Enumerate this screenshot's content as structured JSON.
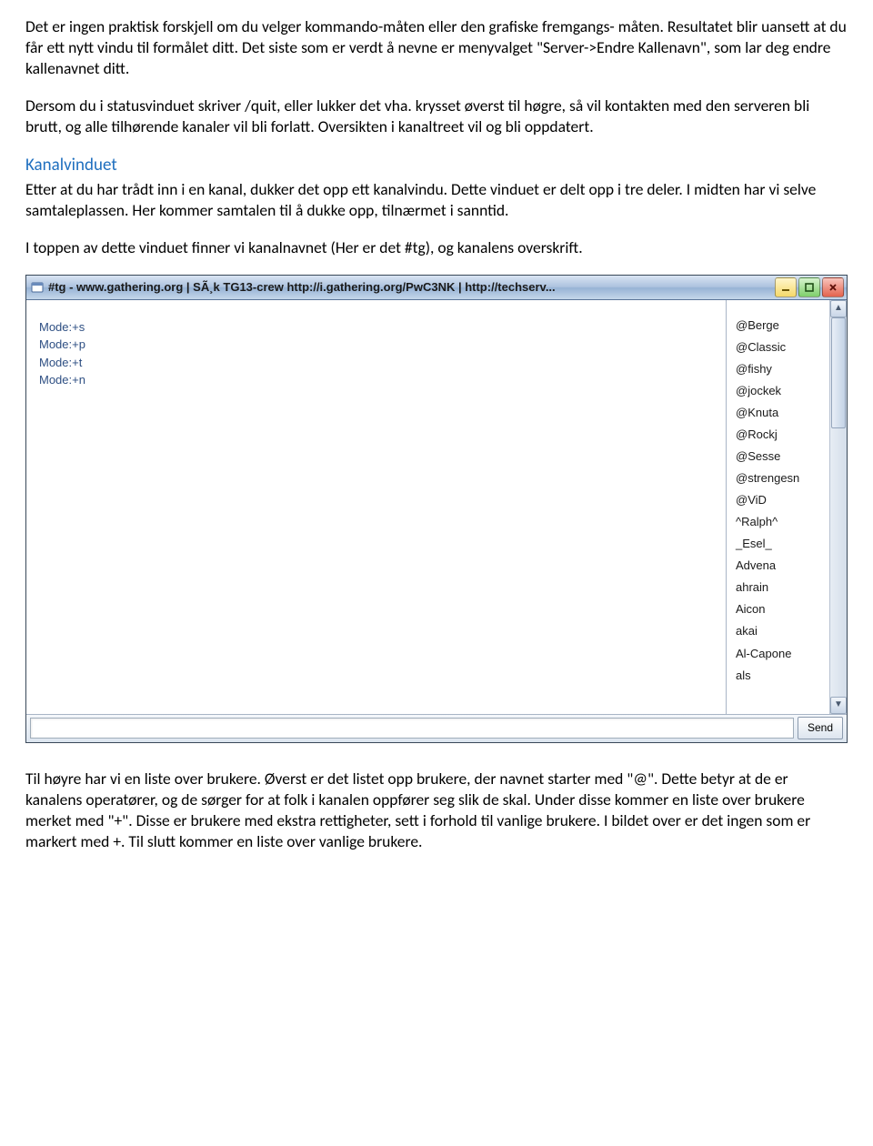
{
  "doc": {
    "p1": "Det er ingen praktisk forskjell om du velger kommando-måten eller den grafiske fremgangs- måten. Resultatet blir uansett at du får ett nytt vindu til formålet ditt. Det siste som er verdt å nevne er menyvalget \"Server->Endre Kallenavn\", som lar deg endre kallenavnet ditt.",
    "p2": "Dersom du i statusvinduet skriver /quit, eller lukker det vha. krysset øverst til høgre, så vil kontakten med den serveren bli brutt, og alle tilhørende kanaler vil bli forlatt. Oversikten i kanaltreet vil og bli oppdatert.",
    "heading": "Kanalvinduet",
    "p3": "Etter at du har trådt inn i en kanal, dukker det opp ett kanalvindu. Dette vinduet er delt opp i tre deler. I midten har vi selve samtaleplassen. Her kommer samtalen til å dukke opp, tilnærmet i sanntid.",
    "p4": "I toppen av dette vinduet finner vi kanalnavnet (Her er det #tg), og kanalens overskrift.",
    "p5": "Til høyre har vi en liste over brukere. Øverst er det listet opp brukere, der navnet starter med \"@\". Dette betyr at de er kanalens operatører, og de sørger for at folk i kanalen oppfører seg slik de skal. Under disse kommer en liste over brukere merket med \"+\". Disse er brukere med ekstra rettigheter, sett i forhold til vanlige brukere. I bildet over er det ingen som er markert med +. Til slutt kommer en liste over vanlige brukere."
  },
  "window": {
    "title": "#tg - www.gathering.org | SÃ¸k TG13-crew http://i.gathering.org/PwC3NK | http://techserv...",
    "modes": [
      "Mode:+s",
      "Mode:+p",
      "Mode:+t",
      "Mode:+n"
    ],
    "users": [
      "@Berge",
      "@Classic",
      "@fishy",
      "@jockek",
      "@Knuta",
      "@Rockj",
      "@Sesse",
      "@strengesn",
      "@ViD",
      "^Ralph^",
      "_Esel_",
      "Advena",
      "ahrain",
      "Aicon",
      "akai",
      "Al-Capone",
      "als"
    ],
    "send_label": "Send"
  }
}
